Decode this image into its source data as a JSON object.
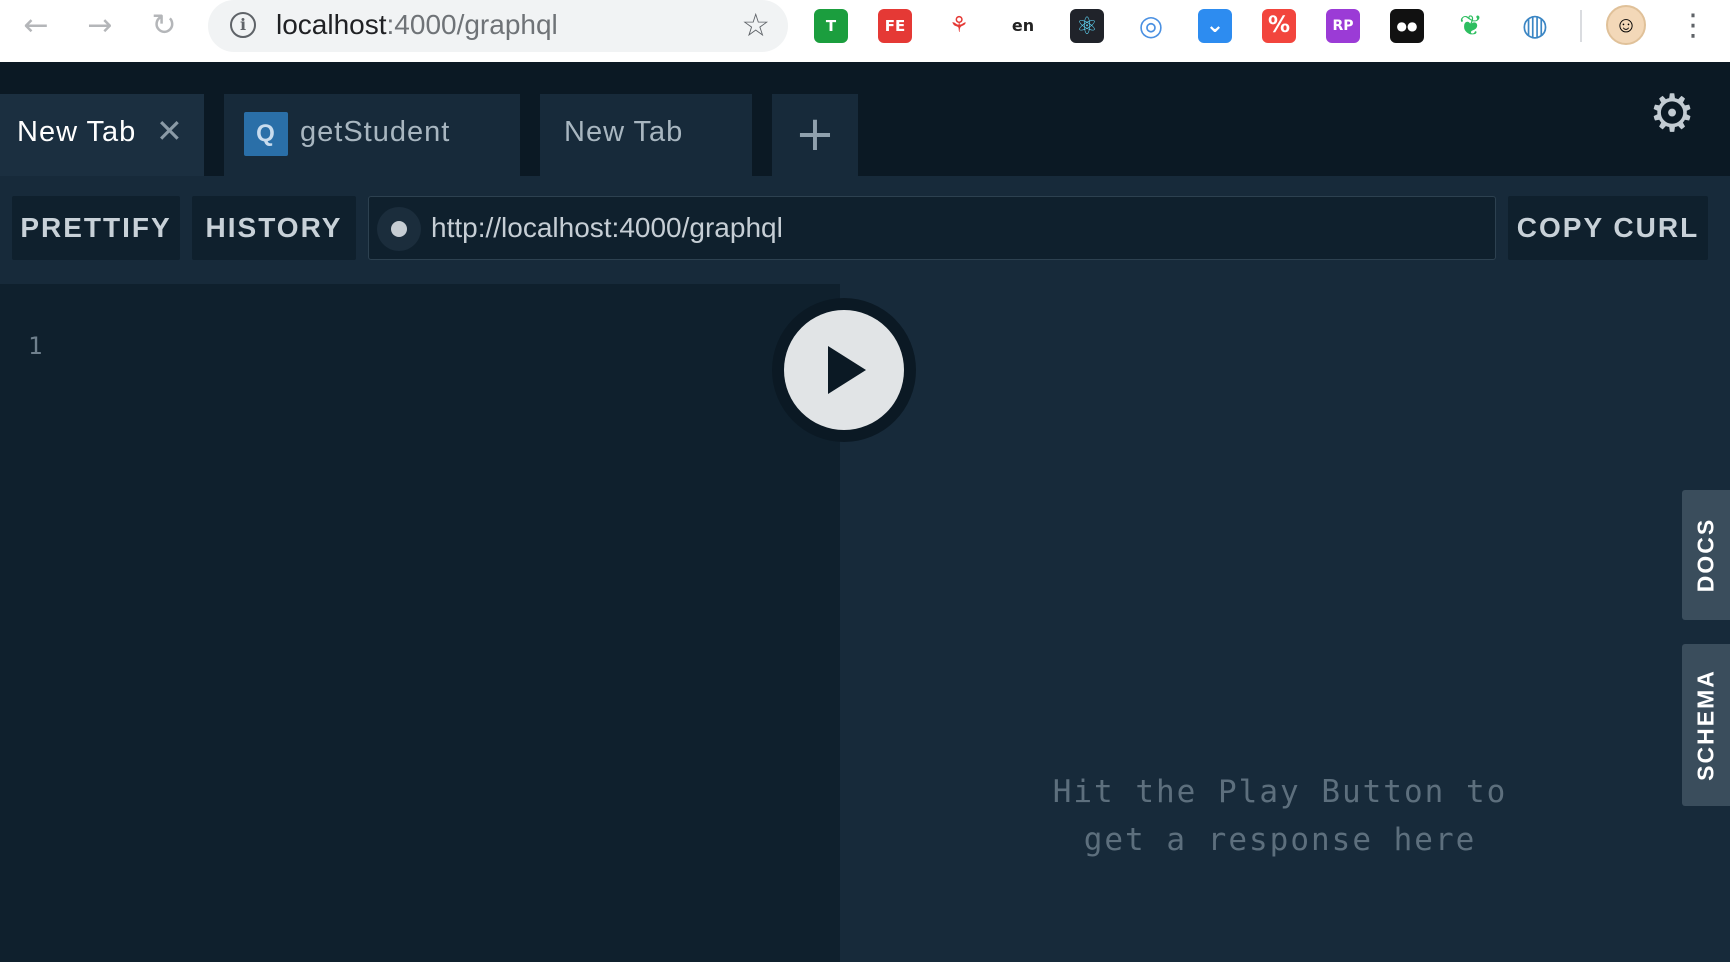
{
  "browser": {
    "url_host": "localhost",
    "url_path": ":4000/graphql",
    "extensions": [
      {
        "name": "tampermonkey-icon",
        "glyph": "T",
        "color": "#1b9e3e"
      },
      {
        "name": "fe-helper-icon",
        "glyph": "FE",
        "color": "#e53935"
      },
      {
        "name": "network-icon",
        "glyph": "⚘",
        "color": "#ffffff"
      },
      {
        "name": "translate-icon",
        "glyph": "en",
        "color": "#ffffff"
      },
      {
        "name": "react-devtools-icon",
        "glyph": "⚛",
        "color": "#20232a"
      },
      {
        "name": "color-picker-icon",
        "glyph": "◎",
        "color": "#ffffff"
      },
      {
        "name": "pocket-icon",
        "glyph": "⌄",
        "color": "#2d8cf0"
      },
      {
        "name": "percent-icon",
        "glyph": "%",
        "color": "#f2453d"
      },
      {
        "name": "rp-icon",
        "glyph": "RP",
        "color": "#9b3bd6"
      },
      {
        "name": "tampermonkey-eyes-icon",
        "glyph": "●●",
        "color": "#111111"
      },
      {
        "name": "evernote-icon",
        "glyph": "❦",
        "color": "#ffffff"
      },
      {
        "name": "globe-icon",
        "glyph": "◍",
        "color": "#ffffff"
      }
    ]
  },
  "tabs": [
    {
      "label": "New Tab",
      "active": true,
      "closable": true
    },
    {
      "label": "getStudent",
      "badge": "Q"
    },
    {
      "label": "New Tab"
    }
  ],
  "toolbar": {
    "prettify_label": "PRETTIFY",
    "history_label": "HISTORY",
    "endpoint": "http://localhost:4000/graphql",
    "copy_curl_label": "COPY CURL"
  },
  "editor": {
    "line_number": "1"
  },
  "result": {
    "placeholder": "Hit the Play Button to get a response here"
  },
  "side_tabs": {
    "docs": "DOCS",
    "schema": "SCHEMA"
  },
  "colors": {
    "background": "#0f202d",
    "panel": "#172a3a",
    "accent": "#2a6fa8"
  }
}
